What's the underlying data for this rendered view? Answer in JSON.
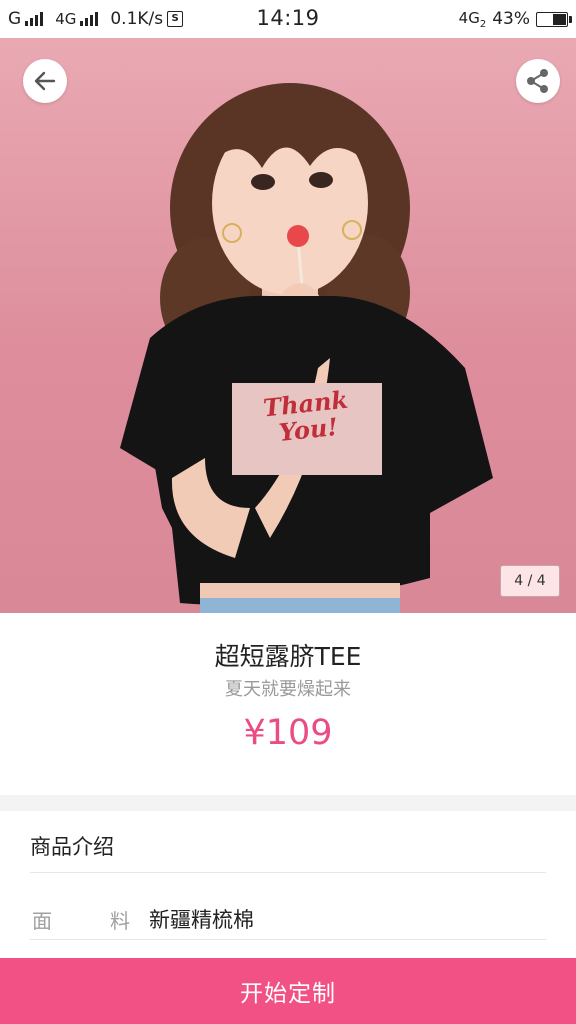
{
  "status_bar": {
    "left_text": "G",
    "network": "4G",
    "speed": "0.1K/s",
    "s_icon": "S",
    "time": "14:19",
    "right_network": "4G",
    "right_network_sub": "2",
    "battery": "43%",
    "icons": [
      "signal-icon",
      "signal-icon",
      "s-icon",
      "battery-icon"
    ]
  },
  "hero": {
    "back_icon": "arrow-left-icon",
    "share_icon": "share-icon",
    "image_text_line1": "Thank",
    "image_text_line2": "You!",
    "page_indicator": "4 / 4",
    "background_color": "#e3a0ab"
  },
  "product": {
    "title": "超短露脐TEE",
    "subtitle": "夏天就要燥起来",
    "price": "¥109",
    "price_color": "#ea4d85"
  },
  "details": {
    "heading": "商品介绍",
    "spec_label_char1": "面",
    "spec_label_char2": "料",
    "spec_value": "新疆精梳棉"
  },
  "cta": {
    "label": "开始定制",
    "color": "#f25185"
  }
}
